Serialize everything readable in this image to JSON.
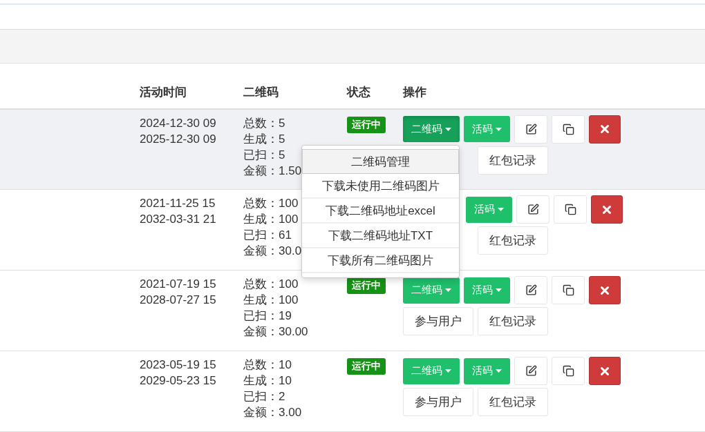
{
  "columns": [
    "活动时间",
    "二维码",
    "状态",
    "操作"
  ],
  "rows": [
    {
      "hovered": true,
      "times": [
        "2024-12-30 09",
        "2025-12-30 09"
      ],
      "stats": [
        {
          "label": "总数：",
          "value": "5"
        },
        {
          "label": "生成：",
          "value": "5"
        },
        {
          "label": "已扫：",
          "value": "5"
        },
        {
          "label": "金额：",
          "value": "1.50"
        }
      ],
      "status": "运行中",
      "qr_button": {
        "label": "二维码",
        "open": true,
        "menu": [
          {
            "label": "二维码管理",
            "selected": true
          },
          {
            "label": "下载未使用二维码图片",
            "selected": false
          },
          {
            "label": "下载二维码地址excel",
            "selected": false
          },
          {
            "label": "下载二维码地址TXT",
            "selected": false
          },
          {
            "label": "下载所有二维码图片",
            "selected": false
          }
        ]
      },
      "live_button": "活码",
      "records_button": "红包记录"
    },
    {
      "hovered": false,
      "times": [
        "2021-11-25 15",
        "2032-03-31 21"
      ],
      "stats": [
        {
          "label": "总数：",
          "value": "100"
        },
        {
          "label": "生成：",
          "value": "100"
        },
        {
          "label": "已扫：",
          "value": "61"
        },
        {
          "label": "金额：",
          "value": "30.0"
        }
      ],
      "live_button": "活码",
      "records_button": "红包记录"
    },
    {
      "hovered": false,
      "times": [
        "2021-07-19 15",
        "2028-07-27 15"
      ],
      "stats": [
        {
          "label": "总数：",
          "value": "100"
        },
        {
          "label": "生成：",
          "value": "100"
        },
        {
          "label": "已扫：",
          "value": "19"
        },
        {
          "label": "金额：",
          "value": "30.00"
        }
      ],
      "status": "运行中",
      "qr_button": {
        "label": "二维码",
        "open": false
      },
      "live_button": "活码",
      "participants_button": "参与用户",
      "records_button": "红包记录"
    },
    {
      "hovered": false,
      "times": [
        "2023-05-19 15",
        "2029-05-23 15"
      ],
      "stats": [
        {
          "label": "总数：",
          "value": "10"
        },
        {
          "label": "生成：",
          "value": "10"
        },
        {
          "label": "已扫：",
          "value": "2"
        },
        {
          "label": "金额：",
          "value": "3.00"
        }
      ],
      "status": "运行中",
      "qr_button": {
        "label": "二维码",
        "open": false
      },
      "live_button": "活码",
      "participants_button": "参与用户",
      "records_button": "红包记录"
    }
  ]
}
